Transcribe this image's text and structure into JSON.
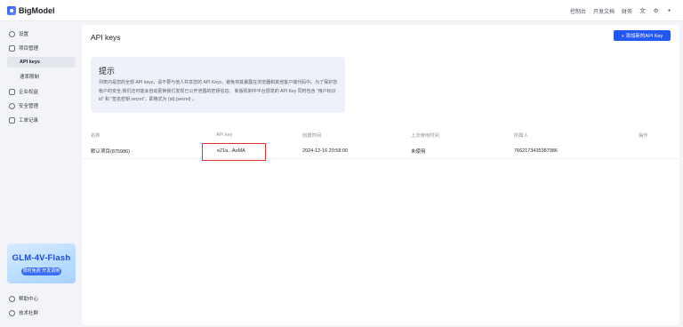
{
  "app": {
    "logo_text": "BigModel"
  },
  "topbar": {
    "nav": [
      "控制台",
      "开发文档",
      "财务"
    ],
    "icons": [
      "language-icon",
      "settings-icon",
      "user-icon"
    ],
    "lang_glyph": "文",
    "gear_glyph": "⚙",
    "user_glyph": "●"
  },
  "sidebar": {
    "items": [
      {
        "label": "设置",
        "icon": "settings-icon"
      },
      {
        "label": "项目管理",
        "icon": "folder-icon"
      },
      {
        "label": "API keys",
        "active": true
      },
      {
        "label": "速率限制"
      },
      {
        "label": "企业权益",
        "icon": "building-icon"
      },
      {
        "label": "安全管理",
        "icon": "lock-icon"
      },
      {
        "label": "工单记录",
        "icon": "ticket-icon"
      }
    ],
    "promo": {
      "title": "GLM-4V-Flash",
      "button": "限时免费 开发调用"
    },
    "bottom": [
      {
        "label": "帮助中心",
        "icon": "help-icon"
      },
      {
        "label": "技术社群",
        "icon": "community-icon"
      }
    ]
  },
  "main": {
    "title": "API keys",
    "create_button": "+ 添加新的API Key",
    "notice": {
      "title": "提示",
      "body": "列表内是您的全部 API keys，请不要与他人共享您的 API Keys，避免将其暴露在浏览器和其他客户端代码中。为了保护您帐户的安全,我们还可能会自动更换我们发现已公开泄露的密钥信息。 新版机制中平台颁发的 API Key 同时包含 “用户标识 id” 和 “签名密钥 secret”，即格式为 {id}.{secret} 。"
    },
    "table": {
      "headers": [
        "名称",
        "API key",
        "创建时间",
        "上次使用时间",
        "所属人",
        "操作"
      ],
      "rows": [
        {
          "name": "默认项目(875986)",
          "api_key": "e21a...AoMA",
          "created": "2024-12-16 20:58:00",
          "last_used": "未使用",
          "owner": "7662173435387986",
          "action": ""
        }
      ]
    }
  },
  "colors": {
    "accent": "#2458f4",
    "highlight_box": "#e2332e"
  }
}
